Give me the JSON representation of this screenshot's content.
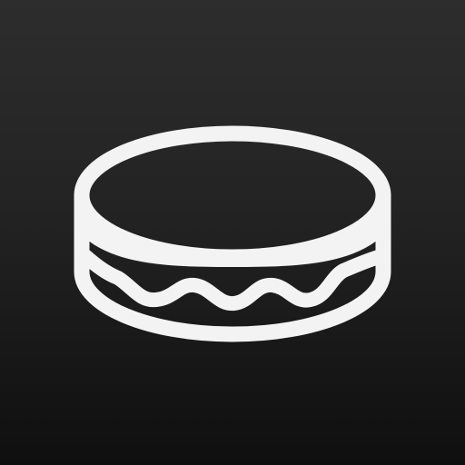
{
  "icon": {
    "name": "puck-sandwich-icon",
    "background_top": "#2d2d2d",
    "background_bottom": "#0f0f0f",
    "stroke_color": "#f3f3f3"
  }
}
